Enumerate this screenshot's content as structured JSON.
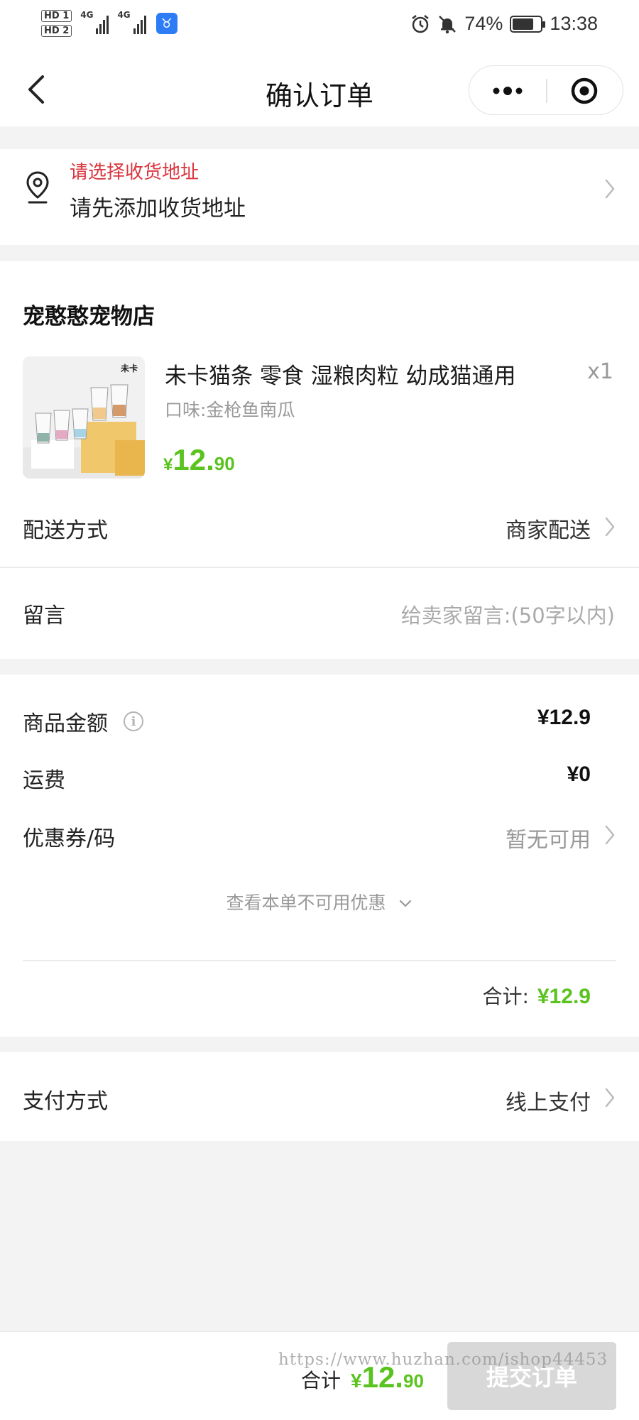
{
  "status_bar": {
    "sim1": "HD 1",
    "sim2": "HD 2",
    "network1": "4G",
    "network2": "4G",
    "battery_percent": "74%",
    "battery_level": 0.74,
    "time": "13:38",
    "icons": [
      "alarm-icon",
      "mute-icon",
      "battery-icon"
    ]
  },
  "nav": {
    "title": "确认订单",
    "back_icon": "chevron-left-icon",
    "more_icon": "more-dots-icon",
    "close_icon": "target-circle-icon"
  },
  "address": {
    "hint": "请选择收货地址",
    "main": "请先添加收货地址"
  },
  "store": {
    "name": "宠憨憨宠物店",
    "product": {
      "title": "未卡猫条 零食 湿粮肉粒 幼成猫通用",
      "quantity": "x1",
      "spec": "口味:金枪鱼南瓜",
      "price_currency": "¥",
      "price_integer": "12.",
      "price_decimal": "90",
      "thumb_brand": "未卡"
    },
    "delivery_label": "配送方式",
    "delivery_value": "商家配送",
    "message_label": "留言",
    "message_placeholder": "给卖家留言:(50字以内)"
  },
  "amounts": {
    "goods_label": "商品金额",
    "goods_value": "¥12.9",
    "shipping_label": "运费",
    "shipping_value": "¥0",
    "coupon_label": "优惠券/码",
    "coupon_value": "暂无可用",
    "unavailable_link": "查看本单不可用优惠",
    "subtotal_label": "合计:",
    "subtotal_value": "¥12.9"
  },
  "payment": {
    "label": "支付方式",
    "value": "线上支付"
  },
  "bottom_bar": {
    "total_label": "合计",
    "price_currency": "¥",
    "price_integer": "12.",
    "price_decimal": "90",
    "submit_label": "提交订单",
    "watermark": "https://www.huzhan.com/ishop44453"
  },
  "colors": {
    "accent_green": "#5ac31f",
    "hint_red": "#d9363e",
    "submit_disabled": "#d8d8d8",
    "page_bg": "#f3f3f3"
  }
}
